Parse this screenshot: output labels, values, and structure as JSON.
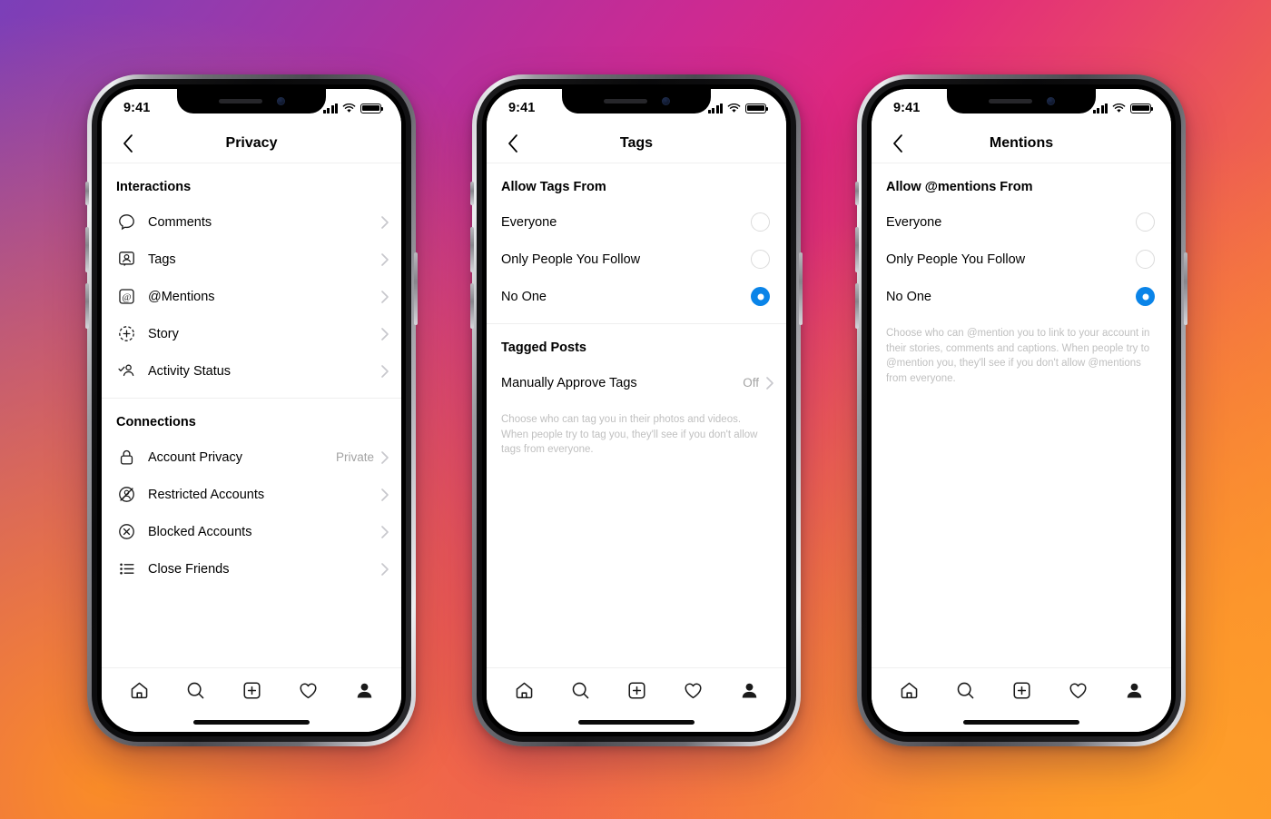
{
  "theme": {
    "accent_blue": "#0a84e8",
    "text_primary": "#000000",
    "text_muted": "#a3a3a3",
    "help_text": "#c0c0c0",
    "divider": "#efefef",
    "background_gradient": [
      "#7b3fb8",
      "#cc2a92",
      "#e0287f",
      "#ee5c53",
      "#f98f2e"
    ]
  },
  "status_bar": {
    "time": "9:41",
    "signal_icon": "cellular-bars-icon",
    "wifi_icon": "wifi-icon",
    "battery_icon": "battery-full-icon"
  },
  "tab_bar": {
    "items": [
      {
        "name": "home-tab",
        "icon": "home-icon"
      },
      {
        "name": "search-tab",
        "icon": "search-icon"
      },
      {
        "name": "create-tab",
        "icon": "plus-square-icon"
      },
      {
        "name": "activity-tab",
        "icon": "heart-icon"
      },
      {
        "name": "profile-tab",
        "icon": "person-filled-icon"
      }
    ]
  },
  "phones": [
    {
      "id": "privacy",
      "nav": {
        "back_icon": "chevron-left-icon",
        "title": "Privacy"
      },
      "sections": [
        {
          "heading": "Interactions",
          "rows": [
            {
              "icon": "comment-bubble-icon",
              "label": "Comments",
              "value": "",
              "chevron": true
            },
            {
              "icon": "tag-person-icon",
              "label": "Tags",
              "value": "",
              "chevron": true
            },
            {
              "icon": "at-mention-icon",
              "label": "@Mentions",
              "value": "",
              "chevron": true
            },
            {
              "icon": "story-plus-icon",
              "label": "Story",
              "value": "",
              "chevron": true
            },
            {
              "icon": "activity-person-check-icon",
              "label": "Activity Status",
              "value": "",
              "chevron": true
            }
          ]
        },
        {
          "heading": "Connections",
          "rows": [
            {
              "icon": "lock-icon",
              "label": "Account Privacy",
              "value": "Private",
              "chevron": true
            },
            {
              "icon": "restricted-person-icon",
              "label": "Restricted Accounts",
              "value": "",
              "chevron": true
            },
            {
              "icon": "blocked-circle-x-icon",
              "label": "Blocked Accounts",
              "value": "",
              "chevron": true
            },
            {
              "icon": "close-friends-list-icon",
              "label": "Close Friends",
              "value": "",
              "chevron": true
            }
          ]
        }
      ]
    },
    {
      "id": "tags",
      "nav": {
        "back_icon": "chevron-left-icon",
        "title": "Tags"
      },
      "radio_group": {
        "heading": "Allow Tags From",
        "options": [
          {
            "label": "Everyone",
            "selected": false
          },
          {
            "label": "Only People You Follow",
            "selected": false
          },
          {
            "label": "No One",
            "selected": true
          }
        ]
      },
      "second_section": {
        "heading": "Tagged Posts",
        "rows": [
          {
            "label": "Manually Approve Tags",
            "value": "Off",
            "chevron": true
          }
        ]
      },
      "help_text": "Choose who can tag you in their photos and videos. When people try to tag you, they'll see if you don't allow tags from everyone."
    },
    {
      "id": "mentions",
      "nav": {
        "back_icon": "chevron-left-icon",
        "title": "Mentions"
      },
      "radio_group": {
        "heading": "Allow @mentions From",
        "options": [
          {
            "label": "Everyone",
            "selected": false
          },
          {
            "label": "Only People You Follow",
            "selected": false
          },
          {
            "label": "No One",
            "selected": true
          }
        ]
      },
      "help_text": "Choose who can @mention you to link to your account in their stories, comments and captions. When people try to @mention you, they'll see if you don't allow @mentions from everyone."
    }
  ]
}
